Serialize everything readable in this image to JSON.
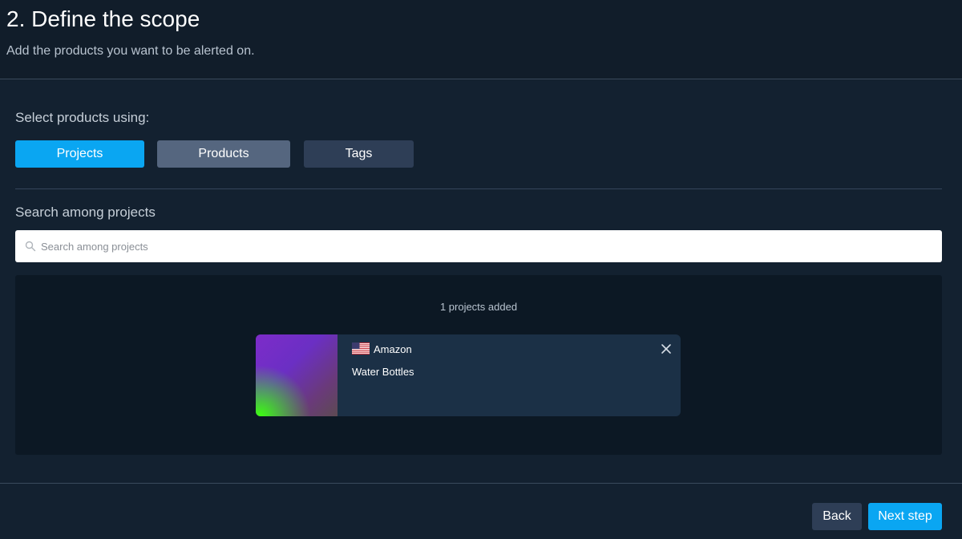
{
  "header": {
    "title": "2. Define the scope",
    "subtitle": "Add the products you want to be alerted on."
  },
  "selector": {
    "label": "Select products using:",
    "options": [
      "Projects",
      "Products",
      "Tags"
    ],
    "selected": "Projects"
  },
  "search": {
    "label": "Search among projects",
    "placeholder": "Search among projects",
    "value": ""
  },
  "added": {
    "count_text": "1 projects added",
    "items": [
      {
        "store": "Amazon",
        "name": "Water Bottles",
        "flag": "us-flag-icon"
      }
    ]
  },
  "footer": {
    "back_label": "Back",
    "next_label": "Next step"
  },
  "colors": {
    "accent": "#0aa6f2",
    "background": "#132130"
  }
}
